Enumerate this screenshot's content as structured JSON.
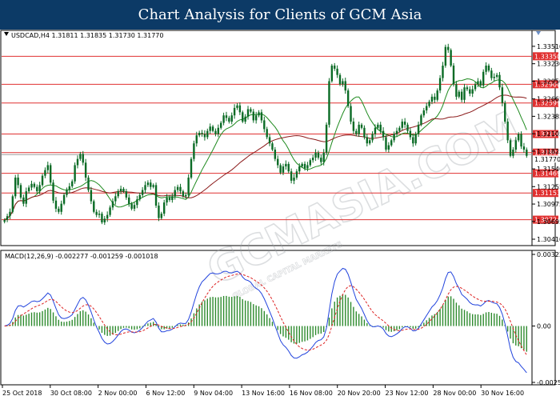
{
  "banner": {
    "title": "Chart Analysis for Clients of GCM Asia"
  },
  "chart_data": [
    {
      "type": "candlestick",
      "header": "USDCAD,H4  1.31811 1.31835 1.31730 1.31770",
      "ylim": [
        1.3041,
        1.3365
      ],
      "price_ticks": [
        "1.33510",
        "1.33230",
        "1.32950",
        "1.32665",
        "1.32385",
        "1.32105",
        "1.31825",
        "1.31540",
        "1.31255",
        "1.30975",
        "1.30695",
        "1.30410"
      ],
      "price_tick_values": [
        1.3351,
        1.3323,
        1.3295,
        1.32665,
        1.32385,
        1.32105,
        1.31825,
        1.3154,
        1.31255,
        1.30975,
        1.30695,
        1.3041
      ],
      "x_labels": [
        "25 Oct 2018",
        "30 Oct 08:00",
        "2 Nov 00:00",
        "6 Nov 12:00",
        "9 Nov 04:00",
        "13 Nov 16:00",
        "16 Nov 08:00",
        "20 Nov 20:00",
        "23 Nov 12:00",
        "28 Nov 00:00",
        "30 Nov 16:00"
      ],
      "levels": [
        {
          "label": "1.33350",
          "value": 1.3335
        },
        {
          "label": "1.32900",
          "value": 1.329
        },
        {
          "label": "1.32599",
          "value": 1.32599
        },
        {
          "label": "1.32100",
          "value": 1.321
        },
        {
          "label": "1.31802",
          "value": 1.31802
        },
        {
          "label": "1.31469",
          "value": 1.31469
        },
        {
          "label": "1.31153",
          "value": 1.31153
        },
        {
          "label": "1.30724",
          "value": 1.30724
        }
      ],
      "current_price": {
        "label": "1.31770",
        "value": 1.3177
      },
      "closes": [
        1.3072,
        1.3078,
        1.3085,
        1.311,
        1.314,
        1.3128,
        1.3108,
        1.3098,
        1.3118,
        1.3124,
        1.313,
        1.3125,
        1.3118,
        1.3128,
        1.3143,
        1.3152,
        1.316,
        1.3132,
        1.3103,
        1.309,
        1.3085,
        1.3098,
        1.3112,
        1.312,
        1.3126,
        1.3134,
        1.316,
        1.317,
        1.3178,
        1.3164,
        1.314,
        1.312,
        1.3102,
        1.3085,
        1.308,
        1.3082,
        1.3068,
        1.3074,
        1.308,
        1.3092,
        1.3102,
        1.311,
        1.3118,
        1.3122,
        1.3118,
        1.3108,
        1.3098,
        1.309,
        1.3096,
        1.3105,
        1.3112,
        1.312,
        1.3128,
        1.3132,
        1.3125,
        1.3128,
        1.3095,
        1.3075,
        1.3082,
        1.31,
        1.3108,
        1.3104,
        1.311,
        1.312,
        1.3125,
        1.3118,
        1.311,
        1.3112,
        1.314,
        1.317,
        1.3195,
        1.3208,
        1.3212,
        1.321,
        1.3205,
        1.3215,
        1.3222,
        1.3215,
        1.321,
        1.322,
        1.3228,
        1.324,
        1.3236,
        1.323,
        1.324,
        1.3252,
        1.3256,
        1.3245,
        1.323,
        1.3238,
        1.325,
        1.3246,
        1.3232,
        1.324,
        1.3245,
        1.3232,
        1.3218,
        1.3205,
        1.3195,
        1.3185,
        1.317,
        1.316,
        1.3148,
        1.3158,
        1.3162,
        1.315,
        1.3135,
        1.314,
        1.315,
        1.3158,
        1.3162,
        1.3155,
        1.316,
        1.3168,
        1.3172,
        1.318,
        1.3172,
        1.3165,
        1.318,
        1.3225,
        1.3295,
        1.332,
        1.3315,
        1.3305,
        1.329,
        1.3295,
        1.328,
        1.3255,
        1.323,
        1.3215,
        1.321,
        1.3225,
        1.322,
        1.3205,
        1.3195,
        1.32,
        1.321,
        1.322,
        1.3225,
        1.3215,
        1.3205,
        1.3185,
        1.3192,
        1.32,
        1.321,
        1.3215,
        1.322,
        1.323,
        1.3225,
        1.3215,
        1.3205,
        1.3195,
        1.321,
        1.3225,
        1.324,
        1.3248,
        1.3255,
        1.3262,
        1.327,
        1.3265,
        1.328,
        1.33,
        1.332,
        1.335,
        1.3345,
        1.332,
        1.329,
        1.327,
        1.3278,
        1.3265,
        1.3285,
        1.3282,
        1.3275,
        1.3282,
        1.329,
        1.3295,
        1.3288,
        1.331,
        1.332,
        1.3312,
        1.33,
        1.3302,
        1.3305,
        1.3285,
        1.326,
        1.323,
        1.32,
        1.3175,
        1.3185,
        1.32,
        1.321,
        1.319,
        1.3185,
        1.3175
      ]
    },
    {
      "type": "macd",
      "label": "MACD(12,26,9) -0.002277 -0.001259 -0.001018",
      "ylim": [
        -0.002536,
        0.003223
      ],
      "ticks": [
        "0.003223",
        "0.00",
        "-0.002536"
      ],
      "tick_values": [
        0.003223,
        0.0,
        -0.002536
      ],
      "histogram_color": "#2e8b2e",
      "macd_color": "#2244dd",
      "signal_color": "#dd2222"
    }
  ],
  "colors": {
    "level_line": "#e03030",
    "level_label_bg": "#e03030",
    "ma_fast": "#1f8a1f",
    "ma_slow": "#8b1a1a",
    "candle": "#0a6b25"
  },
  "watermark": {
    "big": "GCMASIA.COM",
    "small": "GLOBAL CAPITAL MARKETS"
  }
}
